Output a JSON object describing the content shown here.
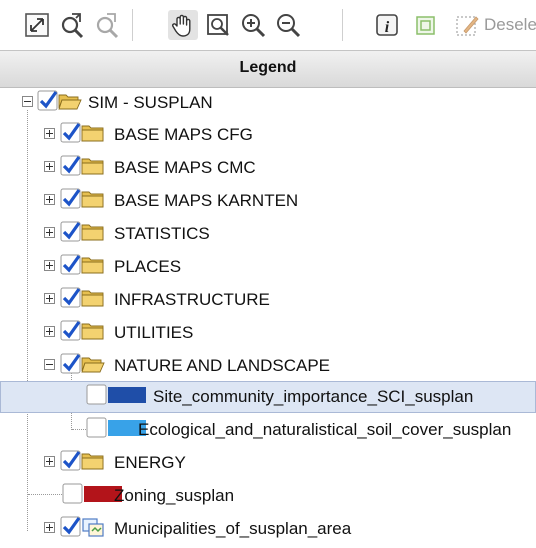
{
  "toolbar": {
    "buttons": [
      {
        "name": "zoom-full-extent-icon"
      },
      {
        "name": "redo-extent-icon"
      },
      {
        "name": "undo-extent-icon"
      },
      {
        "name": "pan-hand-icon"
      },
      {
        "name": "zoom-box-icon"
      },
      {
        "name": "zoom-in-icon"
      },
      {
        "name": "zoom-out-icon"
      },
      {
        "name": "info-icon"
      },
      {
        "name": "select-icon"
      },
      {
        "name": "deselect-icon"
      }
    ],
    "deselect_label": "Desele"
  },
  "legend": {
    "title": "Legend"
  },
  "tree": {
    "root": {
      "label": "SIM - SUSPLAN",
      "checked": true,
      "expanded": true
    },
    "items": [
      {
        "label": "BASE MAPS CFG",
        "checked": true,
        "expanded": false
      },
      {
        "label": "BASE MAPS CMC",
        "checked": true,
        "expanded": false
      },
      {
        "label": "BASE MAPS KARNTEN",
        "checked": true,
        "expanded": false
      },
      {
        "label": "STATISTICS",
        "checked": true,
        "expanded": false
      },
      {
        "label": "PLACES",
        "checked": true,
        "expanded": false
      },
      {
        "label": "INFRASTRUCTURE",
        "checked": true,
        "expanded": false
      },
      {
        "label": "UTILITIES",
        "checked": true,
        "expanded": false
      },
      {
        "label": "NATURE AND LANDSCAPE",
        "checked": true,
        "expanded": true
      },
      {
        "label": "Site_community_importance_SCI_susplan",
        "checked": false,
        "swatch": "#1f4ea8",
        "selected": true
      },
      {
        "label": "Ecological_and_naturalistical_soil_cover_susplan",
        "checked": false,
        "swatch": "#38a2e8"
      },
      {
        "label": "ENERGY",
        "checked": true,
        "expanded": false
      },
      {
        "label": "Zoning_susplan",
        "checked": false,
        "swatch": "#b3141a"
      },
      {
        "label": "Municipalities_of_susplan_area",
        "checked": true,
        "expanded": false
      }
    ]
  },
  "colors": {
    "check_blue": "#1d54c8",
    "folder_yellow": "#f3d270",
    "selection_bg": "#dde6f4"
  }
}
